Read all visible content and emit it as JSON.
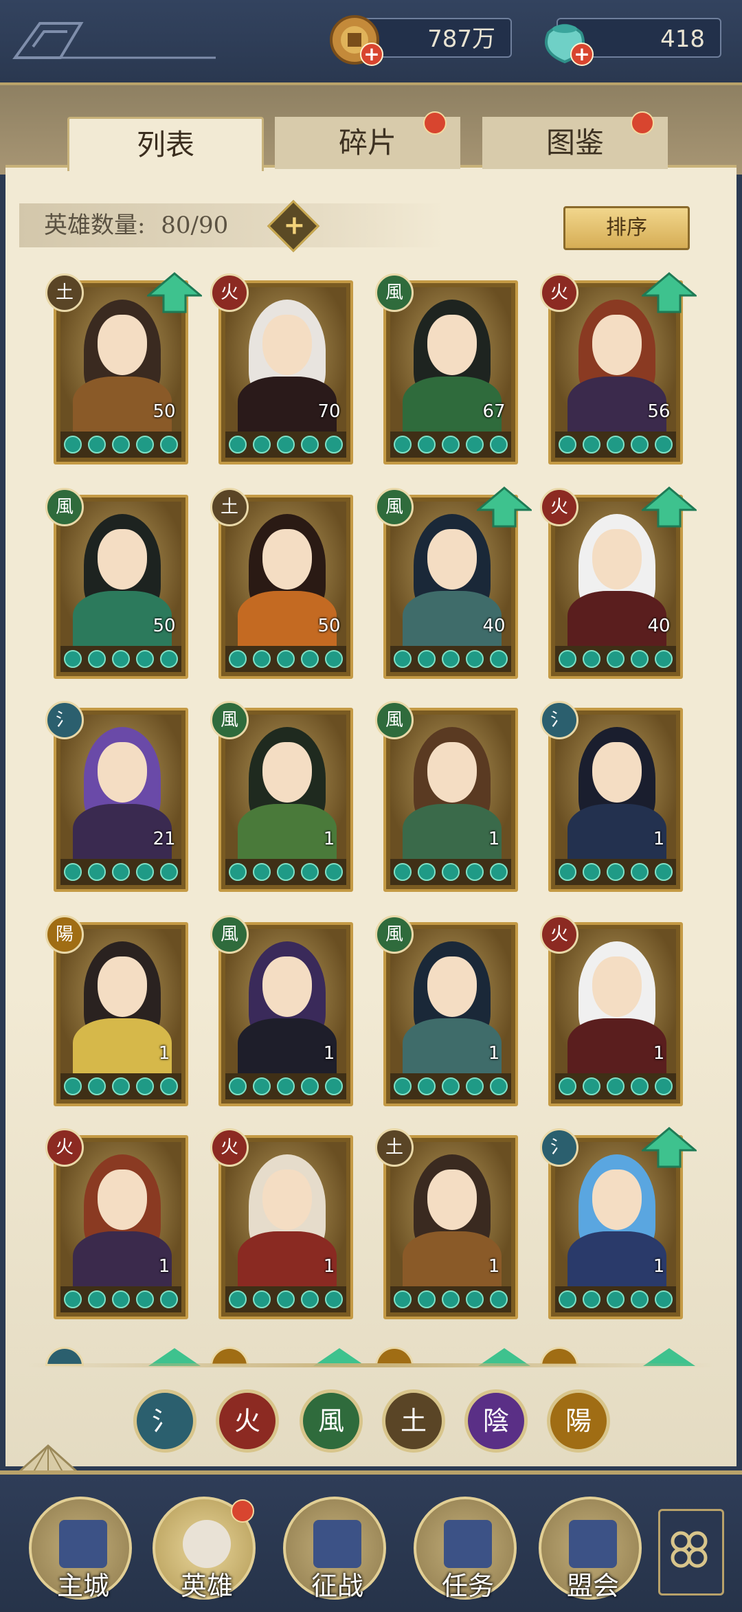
{
  "currency": {
    "copper": "787万",
    "jade": "418"
  },
  "tabs": [
    {
      "label": "列表",
      "active": true
    },
    {
      "label": "碎片",
      "active": false,
      "badge": true
    },
    {
      "label": "图鉴",
      "active": false,
      "badge": true
    }
  ],
  "hero_count": {
    "label": "英雄数量:",
    "value": "80/90"
  },
  "sort_label": "排序",
  "element_glyphs": {
    "water": "氵",
    "fire": "火",
    "wind": "風",
    "earth": "土",
    "yin": "陰",
    "yang": "陽"
  },
  "colors": {
    "water": "#2b5f6e",
    "fire": "#8c2a22",
    "wind": "#2f6b3c",
    "earth": "#5a4526",
    "yin": "#5a2f86",
    "yang": "#a06d14",
    "arrow": "#3ec28e"
  },
  "heroes": [
    {
      "element": "earth",
      "level": "50",
      "upgrade": true,
      "hair": "#3a2a20",
      "outfit": "#8a5a28"
    },
    {
      "element": "fire",
      "level": "70",
      "upgrade": false,
      "hair": "#e8e4df",
      "outfit": "#2a1a1a"
    },
    {
      "element": "wind",
      "level": "67",
      "upgrade": false,
      "hair": "#1e2420",
      "outfit": "#2f6b3c"
    },
    {
      "element": "fire",
      "level": "56",
      "upgrade": true,
      "hair": "#8a3a22",
      "outfit": "#3b2a4c"
    },
    {
      "element": "wind",
      "level": "50",
      "upgrade": false,
      "hair": "#1d2320",
      "outfit": "#2c7a5c"
    },
    {
      "element": "earth",
      "level": "50",
      "upgrade": false,
      "hair": "#2a1a14",
      "outfit": "#c46a22"
    },
    {
      "element": "wind",
      "level": "40",
      "upgrade": true,
      "hair": "#1a2838",
      "outfit": "#3f6c6a"
    },
    {
      "element": "fire",
      "level": "40",
      "upgrade": true,
      "hair": "#f0f0f0",
      "outfit": "#5a1e1e"
    },
    {
      "element": "water",
      "level": "21",
      "upgrade": false,
      "hair": "#6a4aa8",
      "outfit": "#3a2a50"
    },
    {
      "element": "wind",
      "level": "1",
      "upgrade": false,
      "hair": "#1f2a1f",
      "outfit": "#4a7a3a"
    },
    {
      "element": "wind",
      "level": "1",
      "upgrade": false,
      "hair": "#5a3a22",
      "outfit": "#3a6a4a"
    },
    {
      "element": "water",
      "level": "1",
      "upgrade": false,
      "hair": "#1a1e2e",
      "outfit": "#23314f"
    },
    {
      "element": "yang",
      "level": "1",
      "upgrade": false,
      "hair": "#2a2220",
      "outfit": "#d6b84a"
    },
    {
      "element": "wind",
      "level": "1",
      "upgrade": false,
      "hair": "#3a2a5a",
      "outfit": "#1e1e2a"
    },
    {
      "element": "wind",
      "level": "1",
      "upgrade": false,
      "hair": "#1a2838",
      "outfit": "#3f6c6a"
    },
    {
      "element": "fire",
      "level": "1",
      "upgrade": false,
      "hair": "#f0f0f0",
      "outfit": "#5a1e1e"
    },
    {
      "element": "fire",
      "level": "1",
      "upgrade": false,
      "hair": "#8a3a22",
      "outfit": "#3b2a4c"
    },
    {
      "element": "fire",
      "level": "1",
      "upgrade": false,
      "hair": "#e6dccb",
      "outfit": "#8a2a22"
    },
    {
      "element": "earth",
      "level": "1",
      "upgrade": false,
      "hair": "#3a2a20",
      "outfit": "#8a5a28"
    },
    {
      "element": "water",
      "level": "1",
      "upgrade": true,
      "hair": "#5aa6e0",
      "outfit": "#2a3a6a"
    }
  ],
  "peek_row": [
    {
      "element": "water",
      "upgrade": true
    },
    {
      "element": "yang",
      "upgrade": true
    },
    {
      "element": "yang",
      "upgrade": true
    },
    {
      "element": "yang",
      "upgrade": true
    }
  ],
  "filters": [
    "water",
    "fire",
    "wind",
    "earth",
    "yin",
    "yang"
  ],
  "nav": [
    {
      "label": "主城",
      "icon": "city-gate-icon"
    },
    {
      "label": "英雄",
      "icon": "hero-portrait-icon",
      "badge": true
    },
    {
      "label": "征战",
      "icon": "battle-icon"
    },
    {
      "label": "任务",
      "icon": "scroll-quest-icon"
    },
    {
      "label": "盟会",
      "icon": "alliance-gate-icon"
    }
  ]
}
